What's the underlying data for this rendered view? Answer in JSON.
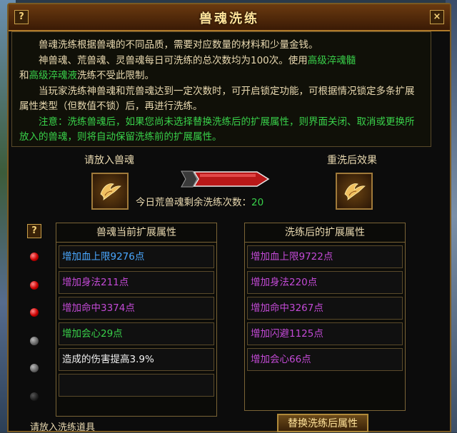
{
  "window": {
    "title": "兽魂洗练",
    "help_glyph": "?",
    "close_glyph": "×"
  },
  "description": {
    "p1": "兽魂洗练根据兽魂的不同品质，需要对应数量的材料和少量金钱。",
    "p2_a": "神兽魂、荒兽魂、灵兽魂每日可洗练的总次数均为100次。使用",
    "p2_hl1": "高级淬魂髓",
    "p2_b": "和",
    "p2_hl2": "高级淬魂液",
    "p2_c": "洗练不受此限制。",
    "p3": "当玩家洗练神兽魂和荒兽魂达到一定次数时，可开启锁定功能，可根据情况锁定多条扩展属性类型（但数值不锁）后，再进行洗练。",
    "p4": "注意：洗练兽魂后，如果您尚未选择替换洗练后的扩展属性，则界面关闭、取消或更换所放入的兽魂，则将自动保留洗练前的扩展属性。"
  },
  "slots": {
    "left_label": "请放入兽魂",
    "right_label": "重洗后效果",
    "icon": "phoenix-icon"
  },
  "count": {
    "label": "今日荒兽魂剩余洗练次数：",
    "value": "20"
  },
  "current": {
    "header": "兽魂当前扩展属性",
    "rows": [
      {
        "text": "增加血上限9276点",
        "color": "#4aa8ff"
      },
      {
        "text": "增加身法211点",
        "color": "#c34ad6"
      },
      {
        "text": "增加命中3374点",
        "color": "#c34ad6"
      },
      {
        "text": "增加会心29点",
        "color": "#39d14a"
      },
      {
        "text": "造成的伤害提高3.9%",
        "color": "#f2f2f2"
      },
      {
        "text": "",
        "color": "#f2f2f2"
      }
    ]
  },
  "after": {
    "header": "洗练后的扩展属性",
    "rows": [
      {
        "text": "增加血上限9722点",
        "color": "#c34ad6"
      },
      {
        "text": "增加身法220点",
        "color": "#c34ad6"
      },
      {
        "text": "增加命中3267点",
        "color": "#c34ad6"
      },
      {
        "text": "增加闪避1125点",
        "color": "#c34ad6"
      },
      {
        "text": "增加会心66点",
        "color": "#c34ad6"
      }
    ]
  },
  "bottom": {
    "left_label": "请放入洗练道具",
    "replace_button": "替换洗练后属性"
  },
  "lock_dots": [
    "red",
    "red",
    "red",
    "gray",
    "gray",
    "dark"
  ]
}
